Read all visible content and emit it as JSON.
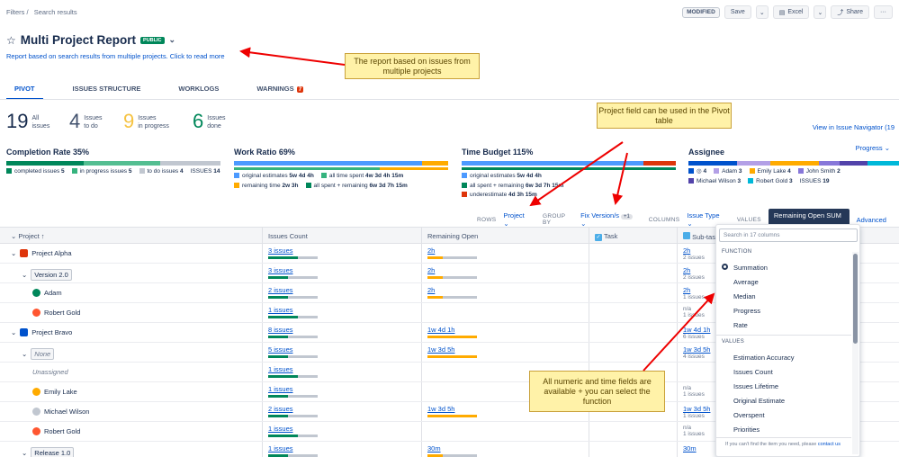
{
  "breadcrumb": {
    "filters": "Filters",
    "sep": "/",
    "current": "Search results"
  },
  "toolbar": {
    "modified": "MODIFIED",
    "save": "Save",
    "excel": "Excel",
    "share": "Share",
    "more": "···"
  },
  "report": {
    "title": "Multi Project Report",
    "badge": "PUBLIC",
    "description": "Report based on search results from multiple projects. Click to read more"
  },
  "tabs": [
    {
      "label": "PIVOT"
    },
    {
      "label": "ISSUES STRUCTURE"
    },
    {
      "label": "WORKLOGS"
    },
    {
      "label": "WARNINGS",
      "badge": "7"
    }
  ],
  "stats": [
    {
      "num": "19",
      "l1": "All",
      "l2": "issues",
      "color": "#172b4d"
    },
    {
      "num": "4",
      "l1": "Issues",
      "l2": "to do",
      "color": "#42526e"
    },
    {
      "num": "9",
      "l1": "Issues",
      "l2": "in progress",
      "color": "#f6c342"
    },
    {
      "num": "6",
      "l1": "Issues",
      "l2": "done",
      "color": "#00875a"
    }
  ],
  "view_navigator": "View in Issue Navigator (19",
  "panels": {
    "completion": {
      "title": "Completion Rate",
      "pct": "35%",
      "l1": "completed issues",
      "v1": "5",
      "l2": "in progress issues",
      "v2": "5",
      "l3": "to do issues",
      "v3": "4",
      "total_label": "ISSUES",
      "total": "14"
    },
    "work": {
      "title": "Work Ratio",
      "pct": "69%",
      "l1": "original estimates",
      "v1": "5w 4d 4h",
      "l2": "all time spent",
      "v2": "4w 3d 4h 15m",
      "l3": "remaining time",
      "v3": "2w 3h",
      "l4": "all spent + remaining",
      "v4": "6w 3d 7h 15m"
    },
    "budget": {
      "title": "Time Budget",
      "pct": "115%",
      "l1": "original estimates",
      "v1": "5w 4d 4h",
      "l2": "all spent + remaining",
      "v2": "6w 3d 7h 15m",
      "l3": "underestimate",
      "v3": "4d 3h 15m"
    },
    "assignee": {
      "title": "Assignee",
      "a1": "4",
      "a2": "Adam",
      "v2": "3",
      "a3": "Emily Lake",
      "v3": "4",
      "a4": "John Smith",
      "v4": "2",
      "a5": "Michael Wilson",
      "v5": "3",
      "a6": "Robert Gold",
      "v6": "3",
      "total_label": "ISSUES",
      "total": "19"
    }
  },
  "progress_select": "Progress",
  "config": {
    "rows_k": "ROWS",
    "rows_v": "Project",
    "group_k": "GROUP BY",
    "group_v": "Fix Version/s",
    "group_plus": "+1",
    "cols_k": "COLUMNS",
    "cols_v": "Issue Type",
    "values_k": "VALUES",
    "values_v": "Remaining Open SUM",
    "advanced": "Advanced"
  },
  "table": {
    "headers": {
      "project": "Project",
      "count": "Issues Count",
      "remaining": "Remaining Open",
      "task": "Task",
      "subtask": "Sub-tas"
    },
    "rows": [
      {
        "label": "Project Alpha",
        "count": "3 issues",
        "rem": "2h",
        "sub": "2h",
        "sub2": "2 issues"
      },
      {
        "label": "Version 2.0",
        "count": "3 issues",
        "rem": "2h",
        "sub": "2h",
        "sub2": "2 issues"
      },
      {
        "label": "Adam",
        "count": "2 issues",
        "rem": "2h",
        "sub": "2h",
        "sub2": "1 issues"
      },
      {
        "label": "Robert Gold",
        "count": "1 issues",
        "rem": "",
        "sub": "n/a",
        "sub2": "1 issues"
      },
      {
        "label": "Project Bravo",
        "count": "8 issues",
        "rem": "1w 4d 1h",
        "sub": "1w 4d 1h",
        "sub2": "6 issues"
      },
      {
        "label": "None",
        "count": "5 issues",
        "rem": "1w 3d 5h",
        "sub": "1w 3d 5h",
        "sub2": "4 issues"
      },
      {
        "label": "Unassigned",
        "count": "1 issues",
        "rem": "",
        "sub": "",
        "sub2": ""
      },
      {
        "label": "Emily Lake",
        "count": "1 issues",
        "rem": "",
        "sub": "n/a",
        "sub2": "1 issues"
      },
      {
        "label": "Michael Wilson",
        "count": "2 issues",
        "rem": "1w 3d 5h",
        "sub": "1w 3d 5h",
        "sub2": "1 issues"
      },
      {
        "label": "Robert Gold",
        "count": "1 issues",
        "rem": "",
        "sub": "n/a",
        "sub2": "1 issues"
      },
      {
        "label": "Release 1.0",
        "count": "1 issues",
        "rem": "30m",
        "sub": "30m",
        "sub2": ""
      }
    ]
  },
  "dropdown": {
    "search_placeholder": "Search in 17 columns",
    "function_header": "FUNCTION",
    "functions": [
      "Summation",
      "Average",
      "Median",
      "Progress",
      "Rate"
    ],
    "values_header": "VALUES",
    "values": [
      "Estimation Accuracy",
      "Issues Count",
      "Issues Lifetime",
      "Original Estimate",
      "Overspent",
      "Priorities"
    ],
    "footer": "If you can't find the item you need, please",
    "footer_link": "contact us"
  },
  "callouts": {
    "c1": "The report based on issues from multiple projects",
    "c2": "Project field can be used in the Pivot table",
    "c3": "All numeric and time fields are available + you can select the function"
  }
}
